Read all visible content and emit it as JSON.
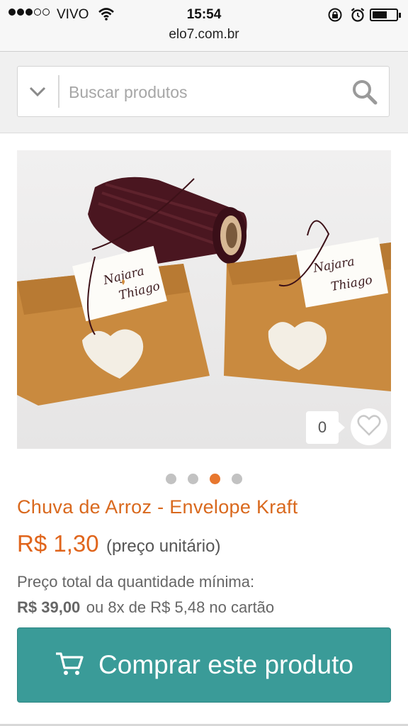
{
  "status_bar": {
    "carrier": "VIVO",
    "time": "15:54",
    "url": "elo7.com.br",
    "signal_bars_filled": 3,
    "signal_bars_total": 5
  },
  "search": {
    "placeholder": "Buscar produtos",
    "value": ""
  },
  "product": {
    "like_count": "0",
    "image_index": 3,
    "image_total": 4,
    "image_labels": [
      "Najara",
      "Thiago"
    ],
    "title": "Chuva de Arroz - Envelope Kraft",
    "price": "R$ 1,30",
    "price_note": "(preço unitário)",
    "min_quantity_label": "Preço total da quantidade mínima:",
    "total_price": "R$ 39,00",
    "installments": "ou 8x de R$ 5,48 no cartão",
    "buy_label": "Comprar este produto"
  },
  "colors": {
    "accent": "#e0651c",
    "button": "#3a9b98",
    "kraft": "#c98a3f"
  },
  "icons": [
    "wifi-icon",
    "rotation-lock-icon",
    "alarm-icon",
    "battery-icon",
    "chevron-down-icon",
    "search-icon",
    "heart-icon",
    "cart-icon"
  ]
}
